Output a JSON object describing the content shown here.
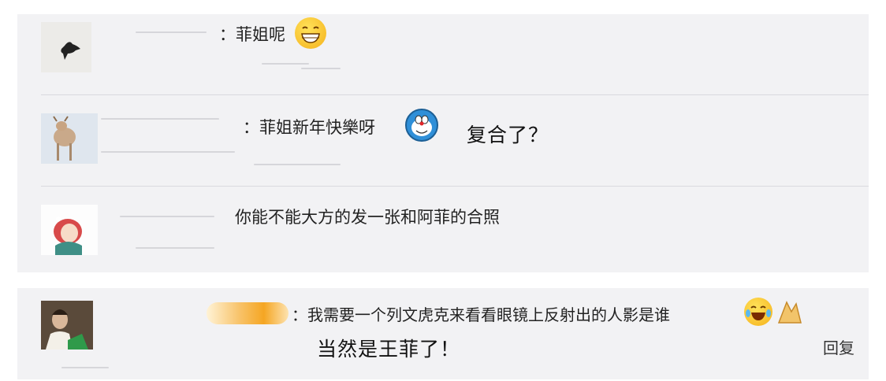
{
  "comments": [
    {
      "text": "：菲姐呢",
      "avatar_icon": "cat-silhouette-icon",
      "emoji_icon": "grinning-face-icon"
    },
    {
      "text": "：菲姐新年快樂呀",
      "avatar_icon": "deer-photo-icon",
      "emoji_icon": "doraemon-icon",
      "annotation": "复合了？"
    },
    {
      "text": "你能不能大方的发一张和阿菲的合照",
      "avatar_icon": "girl-red-hat-icon"
    },
    {
      "text": "：我需要一个列文虎克来看看眼镜上反射出的人影是谁",
      "avatar_icon": "man-green-shirt-icon",
      "emoji_icon": "laughing-tears-icon",
      "emoji_icon_2": "clapping-hands-icon",
      "annotation": "当然是王菲了！",
      "reply_label": "回复"
    }
  ],
  "colors": {
    "panel_bg": "#f2f2f4",
    "divider": "#d9d9de",
    "text": "#222222",
    "badge": "#f5a623"
  }
}
